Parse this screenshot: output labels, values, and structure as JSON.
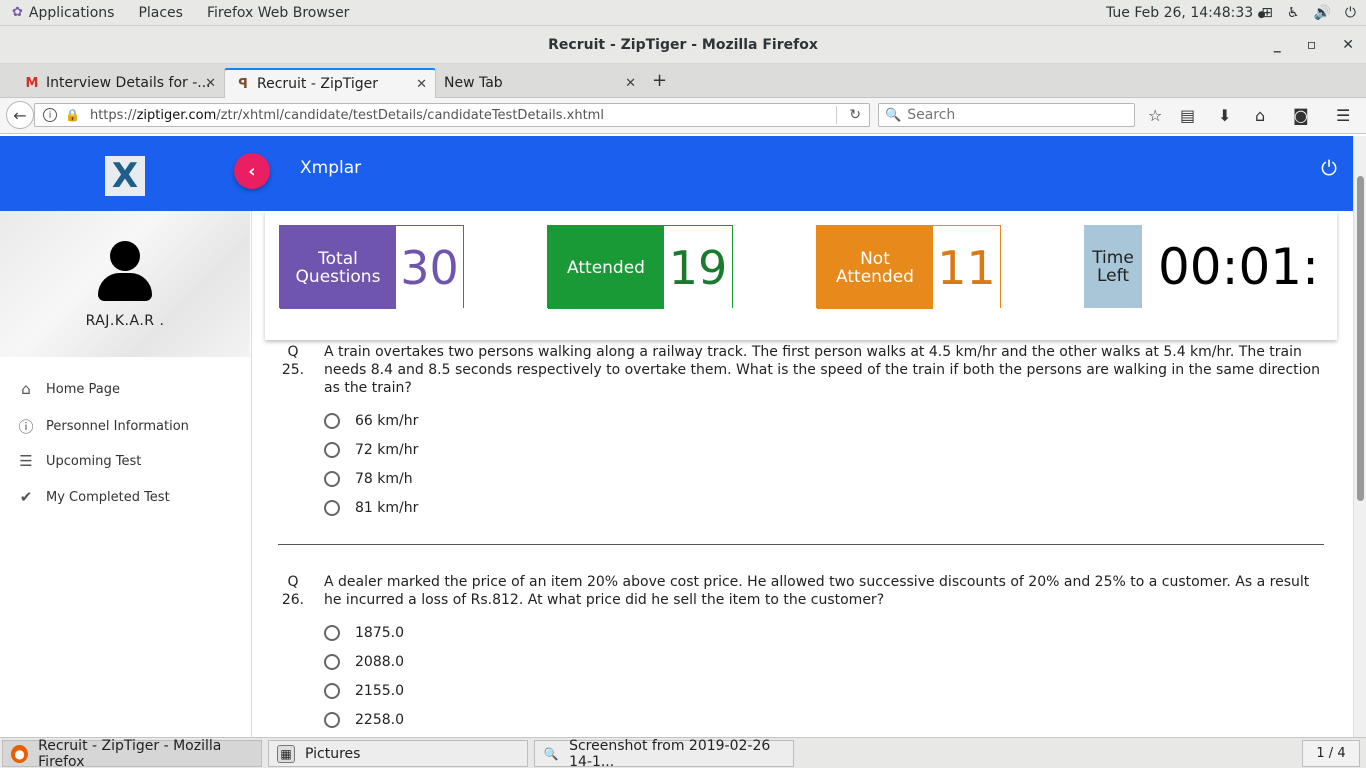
{
  "topbar": {
    "applications": "Applications",
    "places": "Places",
    "app_name": "Firefox Web Browser",
    "clock": "Tue Feb 26, 14:48:33"
  },
  "window": {
    "title": "Recruit - ZipTiger - Mozilla Firefox"
  },
  "tabs": [
    {
      "label": "Interview Details for -...",
      "icon": "gmail-icon"
    },
    {
      "label": "Recruit - ZipTiger",
      "icon": "ziptiger-icon",
      "active": true
    },
    {
      "label": "New Tab",
      "icon": ""
    }
  ],
  "navbar": {
    "url_prefix": "https://",
    "url_domain": "ziptiger.com",
    "url_path": "/ztr/xhtml/candidate/testDetails/candidateTestDetails.xhtml",
    "search_placeholder": "Search"
  },
  "app": {
    "brand": "Xmplar",
    "logo_letter": "X",
    "accent_color": "#1b5fee",
    "collapse_color": "#e91e63"
  },
  "sidebar": {
    "username": "RAJ.K.A.R .",
    "items": [
      {
        "label": "Home Page",
        "icon": "home-icon"
      },
      {
        "label": "Personnel Information",
        "icon": "info-icon"
      },
      {
        "label": "Upcoming Test",
        "icon": "list-icon"
      },
      {
        "label": "My Completed Test",
        "icon": "check-icon"
      }
    ]
  },
  "stats": {
    "total_label_1": "Total",
    "total_label_2": "Questions",
    "total_value": "30",
    "total_color": "#6f55ad",
    "attended_label": "Attended",
    "attended_value": "19",
    "attended_color": "#1a9a37",
    "not_attended_label_1": "Not",
    "not_attended_label_2": "Attended",
    "not_attended_value": "11",
    "not_attended_color": "#e8891b",
    "time_label_1": "Time",
    "time_label_2": "Left",
    "time_value": "00:01:",
    "time_color": "#a9c6d8"
  },
  "questions": [
    {
      "number_prefix": "Q",
      "number": "25.",
      "text": "A train overtakes two persons walking along a railway track. The first person walks at 4.5 km/hr and the other walks at 5.4 km/hr. The train needs 8.4 and 8.5 seconds respectively to overtake them. What is the speed of the train if both the persons are walking in the same direction as the train?",
      "options": [
        "66 km/hr",
        "72 km/hr",
        "78 km/h",
        "81 km/hr"
      ]
    },
    {
      "number_prefix": "Q",
      "number": "26.",
      "text": "A dealer marked the price of an item 20% above cost price. He allowed two successive discounts of 20% and 25% to a customer. As a result he incurred a loss of Rs.812. At what price did he sell the item to the customer?",
      "options": [
        "1875.0",
        "2088.0",
        "2155.0",
        "2258.0"
      ]
    }
  ],
  "taskbar": {
    "items": [
      {
        "label": "Recruit - ZipTiger - Mozilla Firefox",
        "icon": "firefox-icon"
      },
      {
        "label": "Pictures",
        "icon": "folder-icon"
      },
      {
        "label": "Screenshot from 2019-02-26 14-1...",
        "icon": "image-viewer-icon"
      }
    ],
    "pager": "1 / 4"
  }
}
